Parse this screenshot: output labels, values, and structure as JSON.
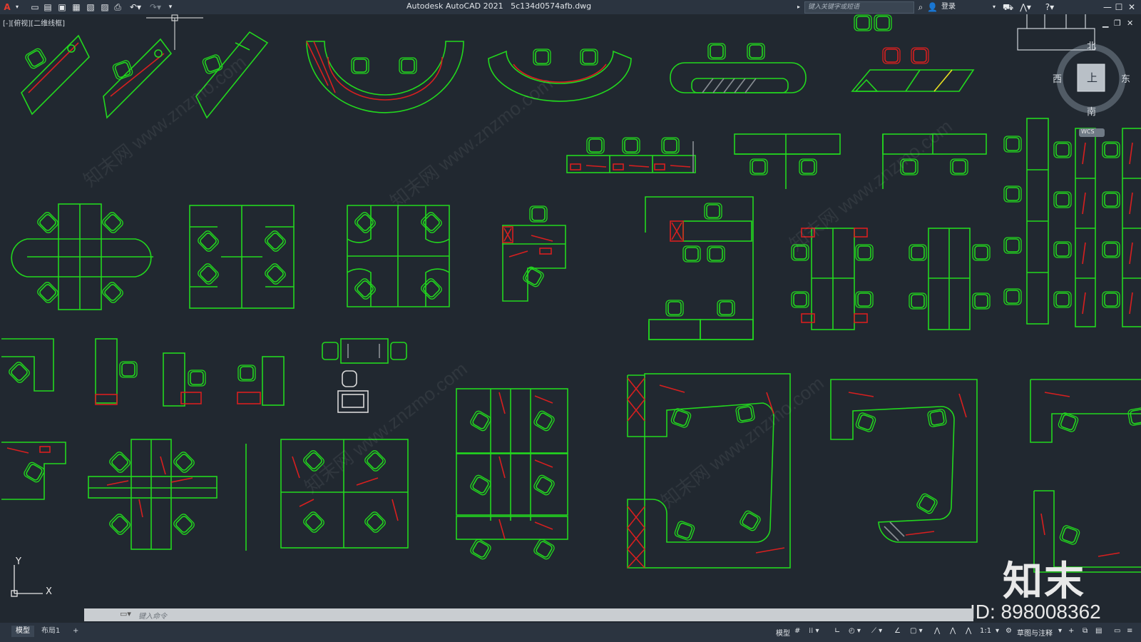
{
  "app": {
    "title": "Autodesk AutoCAD 2021",
    "filename": "5c134d0574afb.dwg",
    "logo": "A"
  },
  "search": {
    "placeholder": "键入关键字或短语"
  },
  "user": {
    "login": "登录"
  },
  "viewport": {
    "label": "[-][俯视][二维线框]"
  },
  "viewcube": {
    "north": "北",
    "south": "南",
    "east": "东",
    "west": "西",
    "top": "上",
    "wcs": "WCS"
  },
  "ucs": {
    "x_label": "X",
    "y_label": "Y"
  },
  "command": {
    "placeholder": "键入命令"
  },
  "tabs": [
    {
      "label": "模型"
    },
    {
      "label": "布局1"
    },
    {
      "label": "+"
    }
  ],
  "status": {
    "model": "模型",
    "scale": "1:1",
    "workspace": "草图与注释"
  },
  "watermark": {
    "logo_text": "知末",
    "id_text": "ID: 898008362",
    "site": "知末网 www.znzmo.com"
  },
  "colors": {
    "background": "#212830",
    "line_green": "#22d81e",
    "line_red": "#d81f1f",
    "ui_dark": "#2b3440"
  }
}
